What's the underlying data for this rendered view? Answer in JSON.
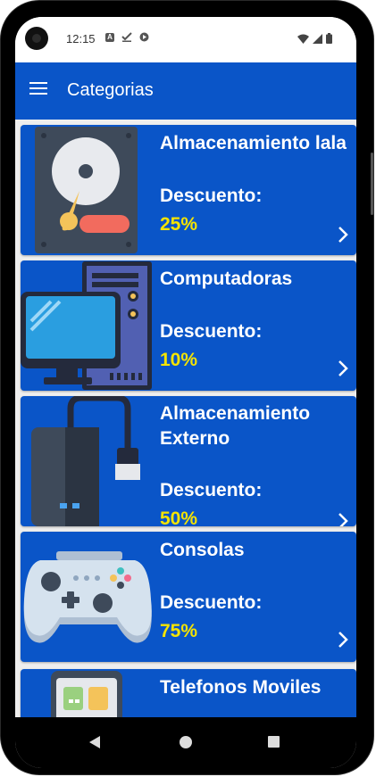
{
  "status_bar": {
    "time": "12:15",
    "icons_left": [
      "A",
      "check-icon",
      "play-store-icon"
    ],
    "icons_right": [
      "wifi-icon",
      "signal-icon",
      "battery-icon"
    ]
  },
  "app_bar": {
    "title": "Categorias",
    "menu_icon": "menu-icon"
  },
  "categories": [
    {
      "title": "Almacenamiento lala",
      "discount_label": "Descuento:",
      "discount_value": "25%",
      "icon": "hard-drive-icon"
    },
    {
      "title": "Computadoras",
      "discount_label": "Descuento:",
      "discount_value": "10%",
      "icon": "desktop-computer-icon"
    },
    {
      "title": "Almacenamiento Externo",
      "discount_label": "Descuento:",
      "discount_value": "50%",
      "icon": "external-drive-icon"
    },
    {
      "title": "Consolas",
      "discount_label": "Descuento:",
      "discount_value": "75%",
      "icon": "gamepad-icon"
    },
    {
      "title": "Telefonos Moviles",
      "discount_label": "",
      "discount_value": "",
      "icon": "smartphone-icon"
    }
  ],
  "colors": {
    "primary": "#0a55c8",
    "discount": "#f5e400",
    "text": "#ffffff"
  },
  "nav_bar": {
    "buttons": [
      "back-icon",
      "home-icon",
      "recent-apps-icon"
    ]
  }
}
